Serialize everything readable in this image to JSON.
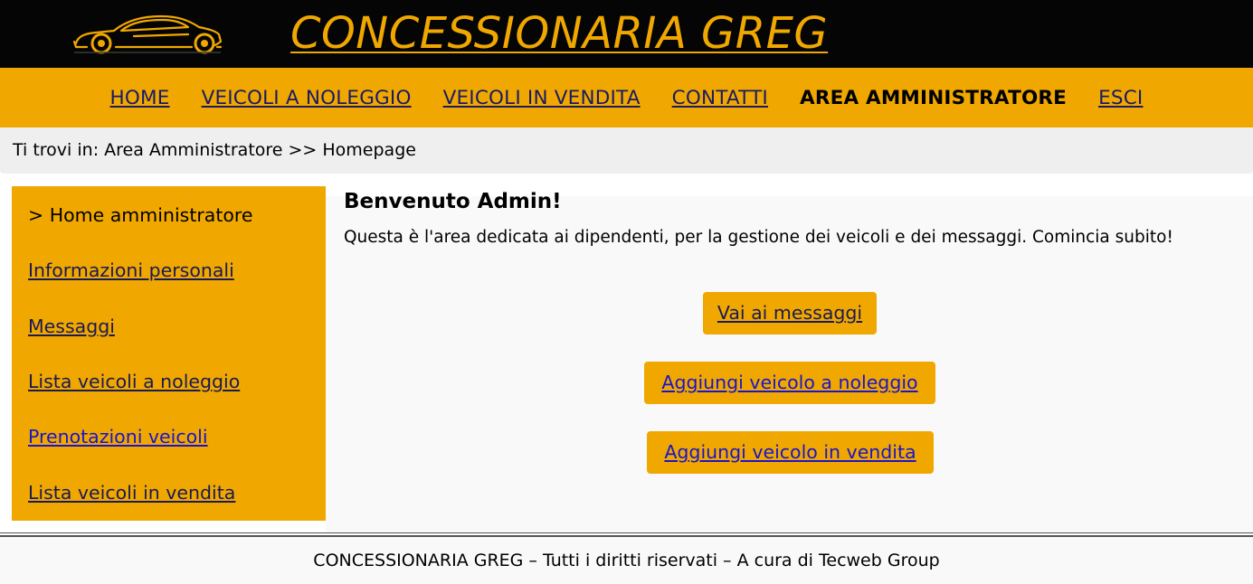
{
  "header": {
    "title": "CONCESSIONARIA GREG",
    "logo_icon": "car-icon",
    "brand_color": "#f0a800"
  },
  "nav": {
    "items": [
      {
        "label": "HOME"
      },
      {
        "label": "VEICOLI A NOLEGGIO"
      },
      {
        "label": "VEICOLI IN VENDITA"
      },
      {
        "label": "CONTATTI"
      },
      {
        "label": "AREA AMMINISTRATORE",
        "active": true
      },
      {
        "label": "ESCI"
      }
    ]
  },
  "breadcrumb": {
    "text": "Ti trovi in: Area Amministratore >> Homepage"
  },
  "sidebar": {
    "items": [
      {
        "label": "> Home amministratore",
        "current": true
      },
      {
        "label": "Informazioni personali"
      },
      {
        "label": "Messaggi"
      },
      {
        "label": "Lista veicoli a noleggio"
      },
      {
        "label": "Prenotazioni veicoli"
      },
      {
        "label": "Lista veicoli in vendita"
      }
    ]
  },
  "main": {
    "title": "Benvenuto Admin!",
    "text": "Questa è l'area dedicata ai dipendenti, per la gestione dei veicoli e dei messaggi. Comincia subito!",
    "buttons": {
      "messages": "Vai ai messaggi",
      "add_rent": "Aggiungi veicolo a noleggio",
      "add_sale": "Aggiungi veicolo in vendita"
    }
  },
  "footer": {
    "text": "CONCESSIONARIA GREG – Tutti i diritti riservati – A cura di Tecweb Group"
  }
}
